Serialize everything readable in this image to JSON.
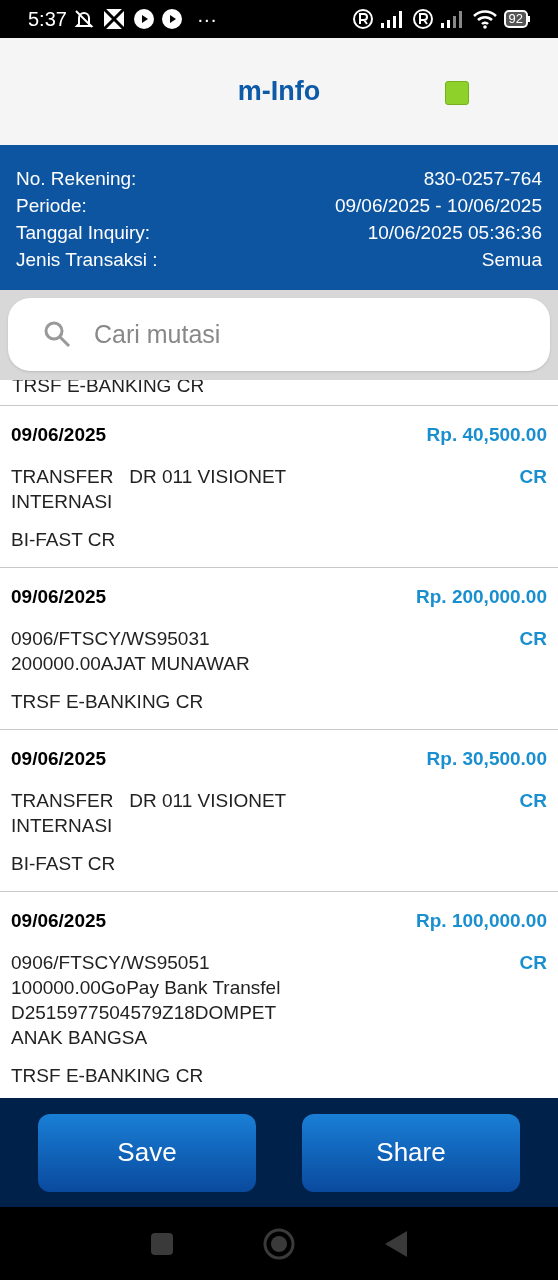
{
  "status_bar": {
    "time": "5:37",
    "more": "···",
    "battery": "92"
  },
  "header": {
    "title": "m-Info"
  },
  "account": [
    {
      "label": "No. Rekening:",
      "value": "830-0257-764"
    },
    {
      "label": "Periode:",
      "value": "09/06/2025 - 10/06/2025"
    },
    {
      "label": "Tanggal Inquiry:",
      "value": "10/06/2025 05:36:36"
    },
    {
      "label": "Jenis Transaksi :",
      "value": "Semua"
    }
  ],
  "search": {
    "placeholder": "Cari mutasi"
  },
  "partial_row": {
    "type": "TRSF E-BANKING CR"
  },
  "transactions": [
    {
      "date": "09/06/2025",
      "amount": "Rp. 40,500.00",
      "description": "TRANSFER   DR 011 VISIONET INTERNASI",
      "flag": "CR",
      "type": "BI-FAST CR"
    },
    {
      "date": "09/06/2025",
      "amount": "Rp. 200,000.00",
      "description": "0906/FTSCY/WS95031 200000.00AJAT MUNAWAR",
      "flag": "CR",
      "type": "TRSF E-BANKING CR"
    },
    {
      "date": "09/06/2025",
      "amount": "Rp. 30,500.00",
      "description": "TRANSFER   DR 011 VISIONET INTERNASI",
      "flag": "CR",
      "type": "BI-FAST CR"
    },
    {
      "date": "09/06/2025",
      "amount": "Rp. 100,000.00",
      "description": "0906/FTSCY/WS95051 100000.00GoPay Bank Transfel D2515977504579Z18DOMPET ANAK BANGSA",
      "flag": "CR",
      "type": "TRSF E-BANKING CR"
    }
  ],
  "buttons": [
    "Save",
    "Share"
  ]
}
